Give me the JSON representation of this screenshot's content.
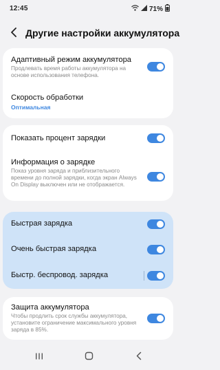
{
  "status": {
    "time": "12:45",
    "battery_pct": "71%"
  },
  "header": {
    "title": "Другие настройки аккумулятора"
  },
  "settings": {
    "adaptive": {
      "title": "Адаптивный режим аккумулятора",
      "subtitle": "Продлевать время работы аккумулятора на основе использования телефона.",
      "enabled": true
    },
    "speed": {
      "title": "Скорость обработки",
      "value": "Оптимальная"
    },
    "show_percent": {
      "title": "Показать процент зарядки",
      "enabled": true
    },
    "charge_info": {
      "title": "Информация о зарядке",
      "subtitle": "Показ уровня заряда и приблизительного времени до полной зарядки, когда экран Always On Display выключен или не отображается.",
      "enabled": true
    },
    "fast": {
      "title": "Быстрая зарядка",
      "enabled": true
    },
    "super_fast": {
      "title": "Очень быстрая зарядка",
      "enabled": true
    },
    "fast_wireless": {
      "title": "Быстр. беспровод. зарядка",
      "enabled": true
    },
    "protect": {
      "title": "Защита аккумулятора",
      "subtitle": "Чтобы продлить срок службы аккумулятора, установите ограничение максимального уровня заряда в 85%.",
      "enabled": true
    }
  },
  "colors": {
    "accent": "#3e87e0",
    "highlight": "#cfe3f8",
    "background": "#f2f2f4"
  },
  "icons": {
    "wifi": "wifi-icon",
    "signal": "signal-icon",
    "battery": "battery-icon",
    "back": "back-arrow-icon",
    "nav_recents": "recents-icon",
    "nav_home": "home-icon",
    "nav_back": "nav-back-icon"
  }
}
